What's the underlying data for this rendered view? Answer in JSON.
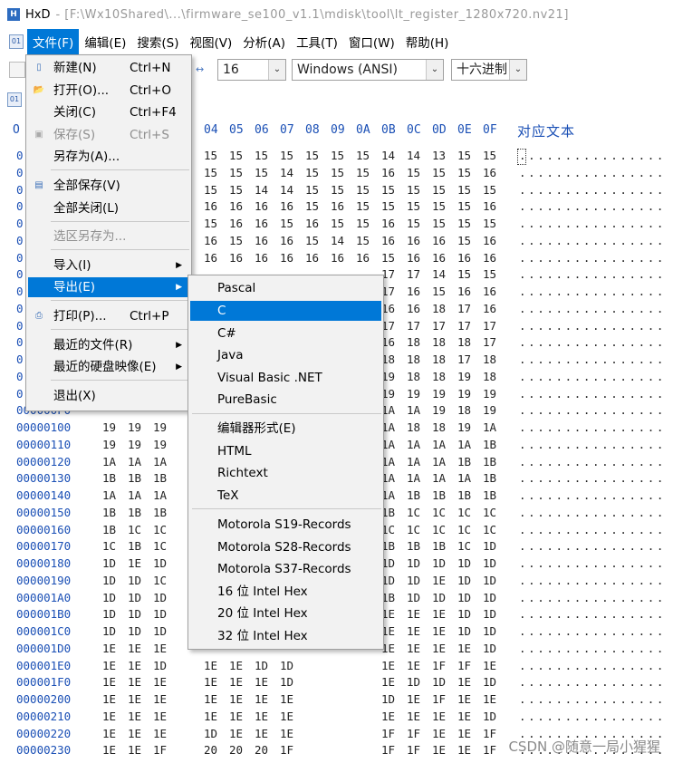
{
  "window": {
    "app_name": "HxD",
    "title_path": "- [F:\\Wx10Shared\\...\\firmware_se100_v1.1\\mdisk\\tool\\lt_register_1280x720.nv21]"
  },
  "menubar": {
    "items": [
      "文件(F)",
      "编辑(E)",
      "搜索(S)",
      "视图(V)",
      "分析(A)",
      "工具(T)",
      "窗口(W)",
      "帮助(H)"
    ]
  },
  "toolbar": {
    "bytes_per_row": "16",
    "charset": "Windows (ANSI)",
    "offset_base": "十六进制",
    "arrows_icon": "↔"
  },
  "hex_header": {
    "offset_label": "O",
    "columns": [
      "04",
      "05",
      "06",
      "07",
      "08",
      "09",
      "0A",
      "0B",
      "0C",
      "0D",
      "0E",
      "0F"
    ],
    "text_label": "对应文本"
  },
  "rows": [
    {
      "off": "0",
      "bytes": [
        "15",
        "15",
        "15",
        "15",
        "15",
        "15",
        "15",
        "14",
        "14",
        "13",
        "15",
        "15"
      ],
      "ascii": "................"
    },
    {
      "off": "0",
      "bytes": [
        "15",
        "15",
        "15",
        "14",
        "15",
        "15",
        "15",
        "16",
        "15",
        "15",
        "15",
        "16"
      ],
      "ascii": "................"
    },
    {
      "off": "0",
      "bytes": [
        "15",
        "15",
        "14",
        "14",
        "15",
        "15",
        "15",
        "15",
        "15",
        "15",
        "15",
        "15"
      ],
      "ascii": "................"
    },
    {
      "off": "0",
      "bytes": [
        "16",
        "16",
        "16",
        "16",
        "15",
        "16",
        "15",
        "15",
        "15",
        "15",
        "15",
        "16"
      ],
      "ascii": "................"
    },
    {
      "off": "0",
      "bytes": [
        "15",
        "16",
        "16",
        "15",
        "16",
        "15",
        "15",
        "16",
        "15",
        "15",
        "15",
        "15"
      ],
      "ascii": "................"
    },
    {
      "off": "0",
      "bytes": [
        "16",
        "15",
        "16",
        "16",
        "15",
        "14",
        "15",
        "16",
        "16",
        "16",
        "15",
        "16"
      ],
      "ascii": "................"
    },
    {
      "off": "0",
      "bytes": [
        "16",
        "16",
        "16",
        "16",
        "16",
        "16",
        "16",
        "15",
        "16",
        "16",
        "16",
        "16"
      ],
      "ascii": "................"
    },
    {
      "off": "0",
      "bytes": [
        "",
        "",
        "",
        "",
        "",
        "",
        "",
        "17",
        "17",
        "14",
        "15",
        "15"
      ],
      "ascii": "................"
    },
    {
      "off": "0",
      "bytes": [
        "",
        "",
        "",
        "",
        "",
        "",
        "",
        "17",
        "16",
        "15",
        "16",
        "16"
      ],
      "ascii": "................"
    },
    {
      "off": "0",
      "bytes": [
        "",
        "",
        "",
        "",
        "",
        "",
        "",
        "16",
        "16",
        "18",
        "17",
        "16"
      ],
      "ascii": "................"
    },
    {
      "off": "0",
      "bytes": [
        "",
        "",
        "",
        "",
        "",
        "",
        "",
        "17",
        "17",
        "17",
        "17",
        "17"
      ],
      "ascii": "................"
    },
    {
      "off": "0",
      "bytes": [
        "",
        "",
        "",
        "",
        "",
        "",
        "",
        "16",
        "18",
        "18",
        "18",
        "17"
      ],
      "ascii": "................"
    },
    {
      "off": "0",
      "bytes": [
        "",
        "",
        "",
        "",
        "",
        "",
        "",
        "18",
        "18",
        "18",
        "17",
        "18"
      ],
      "ascii": "................"
    },
    {
      "off": "0",
      "bytes": [
        "",
        "",
        "",
        "",
        "",
        "",
        "",
        "19",
        "18",
        "18",
        "19",
        "18"
      ],
      "ascii": "................"
    },
    {
      "off": "0",
      "bytes": [
        "",
        "",
        "",
        "",
        "",
        "",
        "",
        "19",
        "19",
        "19",
        "19",
        "19"
      ],
      "ascii": "................"
    },
    {
      "off": "000000F0",
      "bytes": [
        "",
        "",
        "",
        "",
        "",
        "",
        "",
        "1A",
        "1A",
        "19",
        "18",
        "19"
      ],
      "ascii": "................"
    },
    {
      "off": "00000100",
      "bytes": [
        "19",
        "19",
        "19",
        "",
        "",
        "",
        "",
        "1A",
        "18",
        "18",
        "19",
        "1A"
      ],
      "ascii": "................"
    },
    {
      "off": "00000110",
      "bytes": [
        "19",
        "19",
        "19",
        "",
        "",
        "",
        "",
        "1A",
        "1A",
        "1A",
        "1A",
        "1B"
      ],
      "ascii": "................"
    },
    {
      "off": "00000120",
      "bytes": [
        "1A",
        "1A",
        "1A",
        "",
        "",
        "",
        "",
        "1A",
        "1A",
        "1A",
        "1B",
        "1B"
      ],
      "ascii": "................"
    },
    {
      "off": "00000130",
      "bytes": [
        "1B",
        "1B",
        "1B",
        "",
        "",
        "",
        "",
        "1A",
        "1A",
        "1A",
        "1A",
        "1B"
      ],
      "ascii": "................"
    },
    {
      "off": "00000140",
      "bytes": [
        "1A",
        "1A",
        "1A",
        "",
        "",
        "",
        "",
        "1A",
        "1B",
        "1B",
        "1B",
        "1B"
      ],
      "ascii": "................"
    },
    {
      "off": "00000150",
      "bytes": [
        "1B",
        "1B",
        "1B",
        "",
        "",
        "",
        "",
        "1B",
        "1C",
        "1C",
        "1C",
        "1C"
      ],
      "ascii": "................"
    },
    {
      "off": "00000160",
      "bytes": [
        "1B",
        "1C",
        "1C",
        "",
        "",
        "",
        "",
        "1C",
        "1C",
        "1C",
        "1C",
        "1C"
      ],
      "ascii": "................"
    },
    {
      "off": "00000170",
      "bytes": [
        "1C",
        "1B",
        "1C",
        "",
        "",
        "",
        "",
        "1B",
        "1B",
        "1B",
        "1C",
        "1D"
      ],
      "ascii": "................"
    },
    {
      "off": "00000180",
      "bytes": [
        "1D",
        "1E",
        "1D",
        "",
        "",
        "",
        "",
        "1D",
        "1D",
        "1D",
        "1D",
        "1D"
      ],
      "ascii": "................"
    },
    {
      "off": "00000190",
      "bytes": [
        "1D",
        "1D",
        "1C",
        "",
        "",
        "",
        "",
        "1D",
        "1D",
        "1E",
        "1D",
        "1D"
      ],
      "ascii": "................"
    },
    {
      "off": "000001A0",
      "bytes": [
        "1D",
        "1D",
        "1D",
        "",
        "",
        "",
        "",
        "1B",
        "1D",
        "1D",
        "1D",
        "1D"
      ],
      "ascii": "................"
    },
    {
      "off": "000001B0",
      "bytes": [
        "1D",
        "1D",
        "1D",
        "",
        "",
        "",
        "",
        "1E",
        "1E",
        "1E",
        "1D",
        "1D"
      ],
      "ascii": "................"
    },
    {
      "off": "000001C0",
      "bytes": [
        "1D",
        "1D",
        "1D",
        "",
        "",
        "",
        "",
        "1E",
        "1E",
        "1E",
        "1D",
        "1D"
      ],
      "ascii": "................"
    },
    {
      "off": "000001D0",
      "bytes": [
        "1E",
        "1E",
        "1E",
        "",
        "",
        "",
        "",
        "1E",
        "1E",
        "1E",
        "1E",
        "1D"
      ],
      "ascii": "................"
    },
    {
      "off": "000001E0",
      "bytes": [
        "1E",
        "1E",
        "1D",
        "1E",
        "1E",
        "1D",
        "1D",
        "1E",
        "1E",
        "1F",
        "1F",
        "1E"
      ],
      "ascii": "................"
    },
    {
      "off": "000001F0",
      "bytes": [
        "1E",
        "1E",
        "1E",
        "1E",
        "1E",
        "1E",
        "1D",
        "1E",
        "1D",
        "1D",
        "1E",
        "1D"
      ],
      "ascii": "................"
    },
    {
      "off": "00000200",
      "bytes": [
        "1E",
        "1E",
        "1E",
        "1E",
        "1E",
        "1E",
        "1E",
        "1D",
        "1E",
        "1F",
        "1E",
        "1E"
      ],
      "ascii": "................"
    },
    {
      "off": "00000210",
      "bytes": [
        "1E",
        "1E",
        "1E",
        "1E",
        "1E",
        "1E",
        "1E",
        "1E",
        "1E",
        "1E",
        "1E",
        "1D"
      ],
      "ascii": "................"
    },
    {
      "off": "00000220",
      "bytes": [
        "1E",
        "1E",
        "1E",
        "1D",
        "1E",
        "1E",
        "1E",
        "1F",
        "1F",
        "1E",
        "1E",
        "1F"
      ],
      "ascii": "................"
    },
    {
      "off": "00000230",
      "bytes": [
        "1E",
        "1E",
        "1F",
        "20",
        "20",
        "20",
        "1F",
        "1F",
        "1F",
        "1E",
        "1E",
        "1F"
      ],
      "ascii": "................"
    }
  ],
  "file_menu": {
    "items": [
      {
        "label": "新建(N)",
        "accel": "Ctrl+N",
        "icon": "new-file-icon"
      },
      {
        "label": "打开(O)...",
        "accel": "Ctrl+O",
        "icon": "open-folder-icon"
      },
      {
        "label": "关闭(C)",
        "accel": "Ctrl+F4",
        "icon": ""
      },
      {
        "label": "保存(S)",
        "accel": "Ctrl+S",
        "icon": "save-icon",
        "disabled": true
      },
      {
        "label": "另存为(A)...",
        "accel": "",
        "icon": ""
      },
      {
        "label": "全部保存(V)",
        "accel": "",
        "icon": "save-all-icon"
      },
      {
        "label": "全部关闭(L)",
        "accel": "",
        "icon": ""
      },
      {
        "label": "选区另存为...",
        "accel": "",
        "icon": "",
        "disabled": true
      },
      {
        "label": "导入(I)",
        "accel": "",
        "icon": "",
        "submenu": true
      },
      {
        "label": "导出(E)",
        "accel": "",
        "icon": "",
        "submenu": true,
        "highlighted": true
      },
      {
        "label": "打印(P)...",
        "accel": "Ctrl+P",
        "icon": "print-icon"
      },
      {
        "label": "最近的文件(R)",
        "accel": "",
        "icon": "",
        "submenu": true
      },
      {
        "label": "最近的硬盘映像(E)",
        "accel": "",
        "icon": "",
        "submenu": true
      },
      {
        "label": "退出(X)",
        "accel": "",
        "icon": ""
      }
    ]
  },
  "export_menu": {
    "items": [
      "Pascal",
      "C",
      "C#",
      "Java",
      "Visual Basic .NET",
      "PureBasic",
      "编辑器形式(E)",
      "HTML",
      "Richtext",
      "TeX",
      "Motorola S19-Records",
      "Motorola S28-Records",
      "Motorola S37-Records",
      "16 位 Intel Hex",
      "20 位 Intel Hex",
      "32 位 Intel Hex"
    ],
    "highlighted_index": 1
  },
  "watermark": "CSDN @随意一局小猩猩",
  "colors": {
    "accent": "#0078d7",
    "offset_blue": "#1a4fb5",
    "menu_bg": "#f2f2f2"
  }
}
